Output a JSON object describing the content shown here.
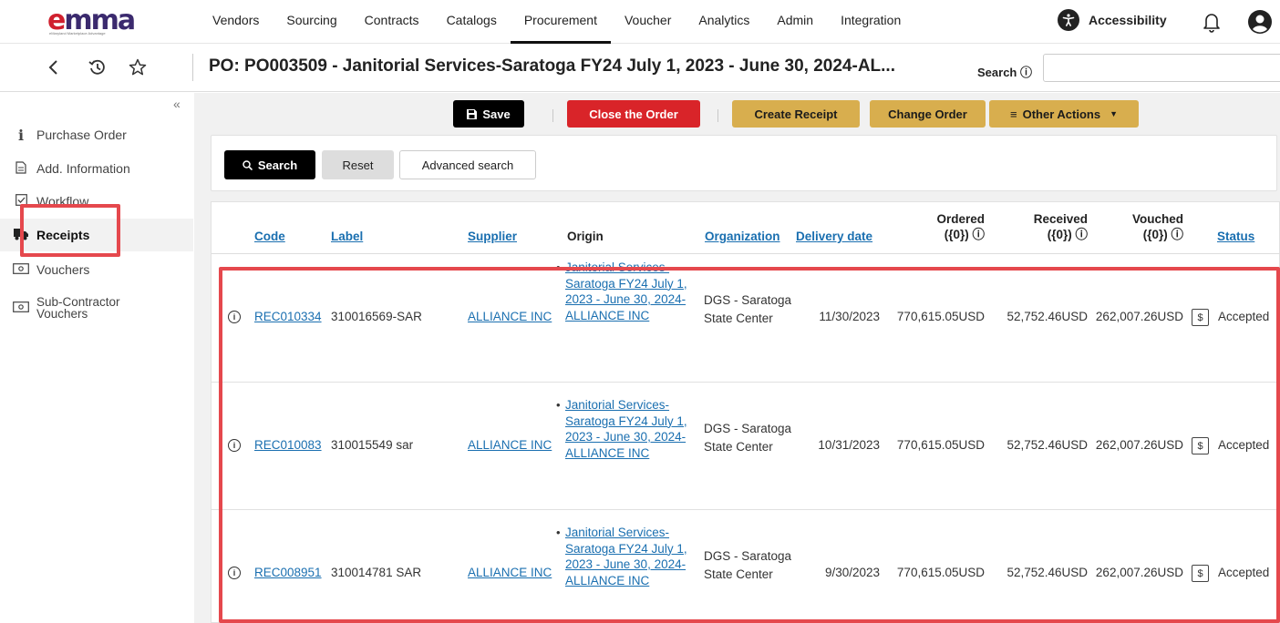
{
  "brand": {
    "logo_text_e": "e",
    "logo_text_rest": "mma",
    "tagline": "eMaryland Marketplace Advantage"
  },
  "nav": {
    "items": [
      "Vendors",
      "Sourcing",
      "Contracts",
      "Catalogs",
      "Procurement",
      "Voucher",
      "Analytics",
      "Admin",
      "Integration"
    ],
    "active": "Procurement",
    "accessibility": "Accessibility"
  },
  "header": {
    "title": "PO: PO003509 - Janitorial Services-Saratoga FY24 July 1, 2023 - June 30, 2024-AL...",
    "search_label": "Search ⓘ",
    "search_value": ""
  },
  "sidebar": {
    "collapse": "«",
    "items": [
      {
        "label": "Purchase Order",
        "icon": "info-icon"
      },
      {
        "label": "Add. Information",
        "icon": "document-icon"
      },
      {
        "label": "Workflow",
        "icon": "checkbox-icon"
      },
      {
        "label": "Receipts",
        "icon": "truck-icon"
      },
      {
        "label": "Vouchers",
        "icon": "money-icon"
      },
      {
        "label": "Sub-Contractor Vouchers",
        "icon": "money-icon"
      }
    ],
    "active": "Receipts"
  },
  "toolbar": {
    "save": "Save",
    "close_order": "Close the Order",
    "create_receipt": "Create Receipt",
    "change_order": "Change Order",
    "other_actions": "Other Actions"
  },
  "search_panel": {
    "search": "Search",
    "reset": "Reset",
    "advanced": "Advanced search"
  },
  "table": {
    "headers": {
      "code": "Code",
      "label": "Label",
      "supplier": "Supplier",
      "origin": "Origin",
      "organization": "Organization",
      "delivery_date": "Delivery date",
      "ordered": "Ordered",
      "ordered_sub": "({0}) ⓘ",
      "received": "Received",
      "received_sub": "({0}) ⓘ",
      "vouched": "Vouched",
      "vouched_sub": "({0}) ⓘ",
      "status": "Status"
    },
    "rows": [
      {
        "code": "REC010334",
        "label": "310016569-SAR",
        "supplier": "ALLIANCE INC",
        "origin": "Janitorial Services-Saratoga FY24 July 1, 2023 - June 30, 2024-ALLIANCE INC",
        "organization": "DGS - Saratoga State Center",
        "delivery_date": "11/30/2023",
        "ordered": "770,615.05USD",
        "received": "52,752.46USD",
        "vouched": "262,007.26USD",
        "status": "Accepted"
      },
      {
        "code": "REC010083",
        "label": "310015549 sar",
        "supplier": "ALLIANCE INC",
        "origin": "Janitorial Services-Saratoga FY24 July 1, 2023 - June 30, 2024-ALLIANCE INC",
        "organization": "DGS - Saratoga State Center",
        "delivery_date": "10/31/2023",
        "ordered": "770,615.05USD",
        "received": "52,752.46USD",
        "vouched": "262,007.26USD",
        "status": "Accepted"
      },
      {
        "code": "REC008951",
        "label": "310014781 SAR",
        "supplier": "ALLIANCE INC",
        "origin": "Janitorial Services-Saratoga FY24 July 1, 2023 - June 30, 2024-ALLIANCE INC",
        "organization": "DGS - Saratoga State Center",
        "delivery_date": "9/30/2023",
        "ordered": "770,615.05USD",
        "received": "52,752.46USD",
        "vouched": "262,007.26USD",
        "status": "Accepted"
      }
    ]
  },
  "colors": {
    "link": "#1a6fb0",
    "danger": "#d92429",
    "gold": "#d8ae4e",
    "highlight": "#e5484d"
  }
}
